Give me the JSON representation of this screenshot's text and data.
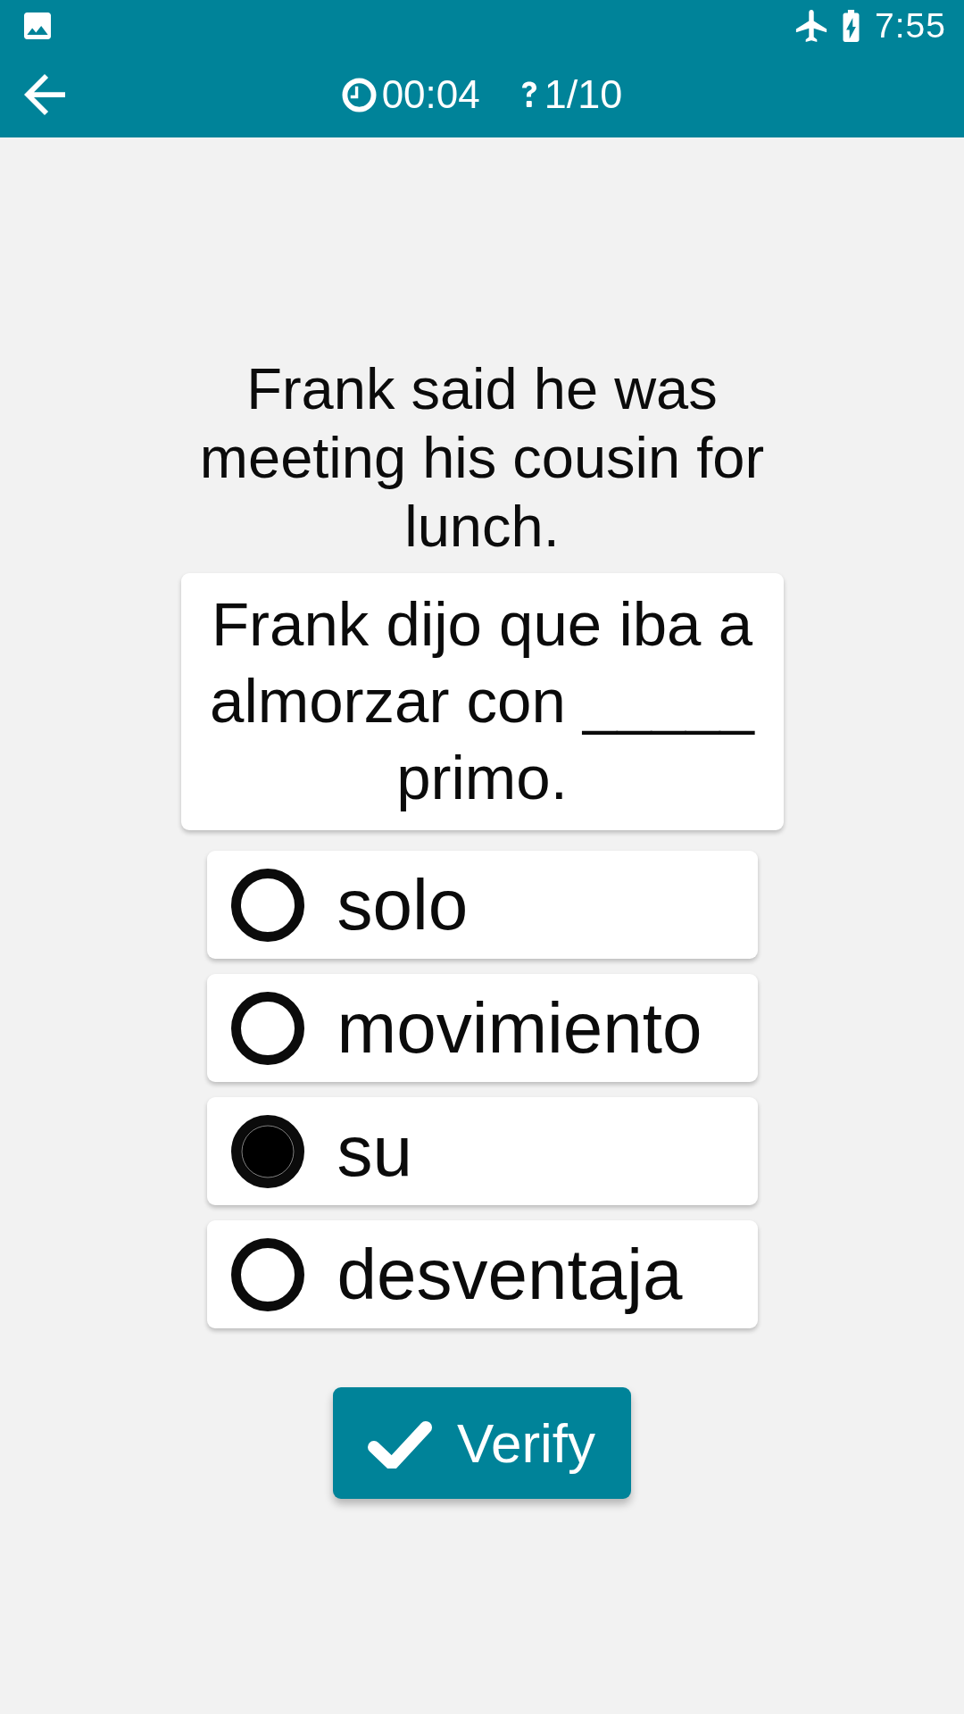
{
  "status_bar": {
    "time": "7:55"
  },
  "app_bar": {
    "timer": "00:04",
    "progress": "1/10"
  },
  "question": {
    "prompt": "Frank said he was meeting his cousin for lunch.",
    "sentence": "Frank dijo que iba a almorzar con _____ primo."
  },
  "options": [
    {
      "label": "solo",
      "selected": false
    },
    {
      "label": "movimiento",
      "selected": false
    },
    {
      "label": "su",
      "selected": true
    },
    {
      "label": "desventaja",
      "selected": false
    }
  ],
  "verify_button": {
    "label": "Verify"
  }
}
